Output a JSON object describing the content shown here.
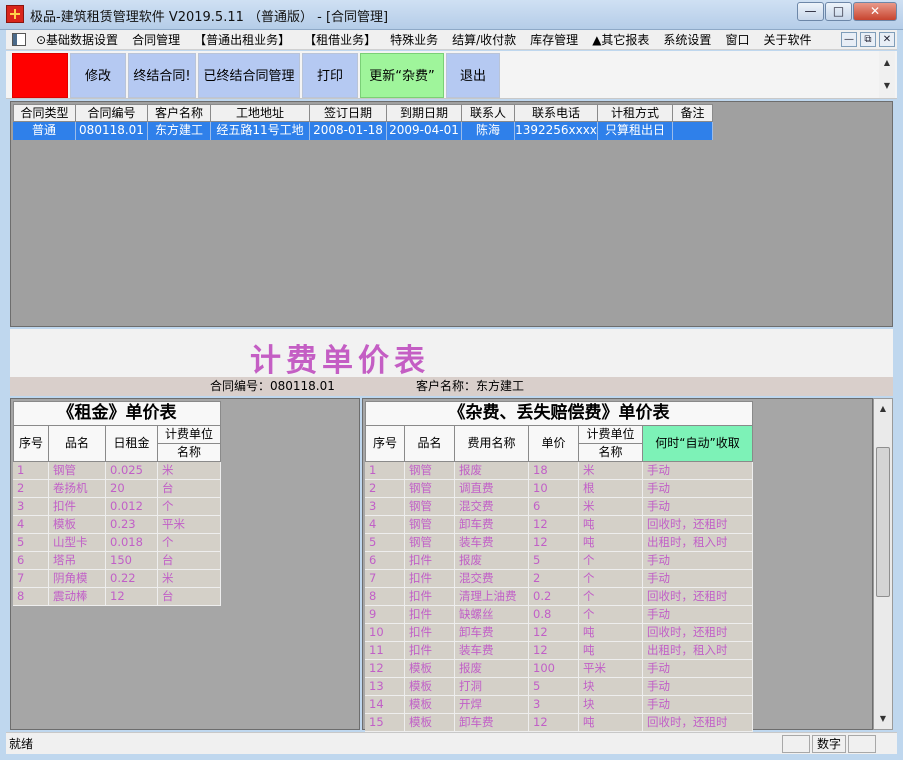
{
  "window": {
    "title": "极品-建筑租赁管理软件 V2019.5.11 （普通版） - [合同管理]"
  },
  "menu": [
    "⊙基础数据设置",
    "合同管理",
    "【普通出租业务】",
    "【租借业务】",
    "特殊业务",
    "结算/收付款",
    "库存管理",
    "▲其它报表",
    "系统设置",
    "窗口",
    "关于软件"
  ],
  "toolbar": {
    "edit": "修改",
    "terminate": "终结合同!",
    "terminated_mgmt": "已终结合同管理",
    "print": "打印",
    "update_fee": "更新“杂费”",
    "exit": "退出"
  },
  "contract_grid": {
    "headers": [
      "合同类型",
      "合同编号",
      "客户名称",
      "工地地址",
      "签订日期",
      "到期日期",
      "联系人",
      "联系电话",
      "计租方式",
      "备注"
    ],
    "row": [
      "普通",
      "080118.01",
      "东方建工",
      "经五路11号工地",
      "2008-01-18",
      "2009-04-01",
      "陈海",
      "1392256xxxx",
      "只算租出日",
      ""
    ]
  },
  "price_title": "计费单价表",
  "contract_info": {
    "no_label": "合同编号：080118.01",
    "customer_label": "客户名称：东方建工"
  },
  "rent_table": {
    "title": "《租金》单价表",
    "headers": {
      "no": "序号",
      "name": "品名",
      "daily": "日租金",
      "unit_top": "计费单位",
      "unit_bottom": "名称"
    },
    "rows": [
      [
        "1",
        "钢管",
        "0.025",
        "米"
      ],
      [
        "2",
        "卷扬机",
        "20",
        "台"
      ],
      [
        "3",
        "扣件",
        "0.012",
        "个"
      ],
      [
        "4",
        "模板",
        "0.23",
        "平米"
      ],
      [
        "5",
        "山型卡",
        "0.018",
        "个"
      ],
      [
        "6",
        "塔吊",
        "150",
        "台"
      ],
      [
        "7",
        "阴角模",
        "0.22",
        "米"
      ],
      [
        "8",
        "震动棒",
        "12",
        "台"
      ]
    ]
  },
  "fee_table": {
    "title": "《杂费、丢失赔偿费》单价表",
    "headers": {
      "no": "序号",
      "name": "品名",
      "fee_name": "费用名称",
      "price": "单价",
      "unit_top": "计费单位",
      "unit_bottom": "名称",
      "when": "何时“自动”收取"
    },
    "rows": [
      [
        "1",
        "钢管",
        "报废",
        "18",
        "米",
        "手动"
      ],
      [
        "2",
        "钢管",
        "调直费",
        "10",
        "根",
        "手动"
      ],
      [
        "3",
        "钢管",
        "混交费",
        "6",
        "米",
        "手动"
      ],
      [
        "4",
        "钢管",
        "卸车费",
        "12",
        "吨",
        "回收时，还租时"
      ],
      [
        "5",
        "钢管",
        "装车费",
        "12",
        "吨",
        "出租时，租入时"
      ],
      [
        "6",
        "扣件",
        "报废",
        "5",
        "个",
        "手动"
      ],
      [
        "7",
        "扣件",
        "混交费",
        "2",
        "个",
        "手动"
      ],
      [
        "8",
        "扣件",
        "清理上油费",
        "0.2",
        "个",
        "回收时，还租时"
      ],
      [
        "9",
        "扣件",
        "缺螺丝",
        "0.8",
        "个",
        "手动"
      ],
      [
        "10",
        "扣件",
        "卸车费",
        "12",
        "吨",
        "回收时，还租时"
      ],
      [
        "11",
        "扣件",
        "装车费",
        "12",
        "吨",
        "出租时，租入时"
      ],
      [
        "12",
        "模板",
        "报废",
        "100",
        "平米",
        "手动"
      ],
      [
        "13",
        "模板",
        "打洞",
        "5",
        "块",
        "手动"
      ],
      [
        "14",
        "模板",
        "开焊",
        "3",
        "块",
        "手动"
      ],
      [
        "15",
        "模板",
        "卸车费",
        "12",
        "吨",
        "回收时，还租时"
      ]
    ]
  },
  "status": {
    "text": "就绪",
    "numlock": "数字"
  }
}
